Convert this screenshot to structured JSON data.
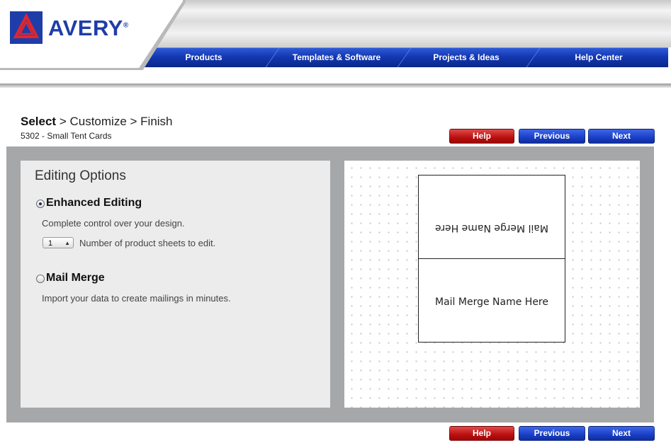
{
  "brand": {
    "logo_text": "AVERY",
    "trademark": "®",
    "color": "#1f3da8"
  },
  "nav": {
    "items": [
      {
        "label": "Products"
      },
      {
        "label": "Templates & Software"
      },
      {
        "label": "Projects & Ideas"
      },
      {
        "label": "Help Center"
      }
    ]
  },
  "steps": {
    "current": "Select",
    "rest": "> Customize > Finish",
    "product": "5302 - Small Tent Cards"
  },
  "buttons": {
    "help": "Help",
    "previous": "Previous",
    "next": "Next"
  },
  "options": {
    "title": "Editing Options",
    "enhanced": {
      "label": "Enhanced Editing",
      "description": "Complete control over your design.",
      "sheet_count": "1",
      "sheet_label": "Number of product sheets to edit.",
      "selected": true
    },
    "mail_merge": {
      "label": "Mail Merge",
      "description": "Import your data to create mailings in minutes.",
      "selected": false
    }
  },
  "preview": {
    "top_text": "Mail Merge Name Here",
    "bottom_text": "Mail Merge Name Here"
  }
}
